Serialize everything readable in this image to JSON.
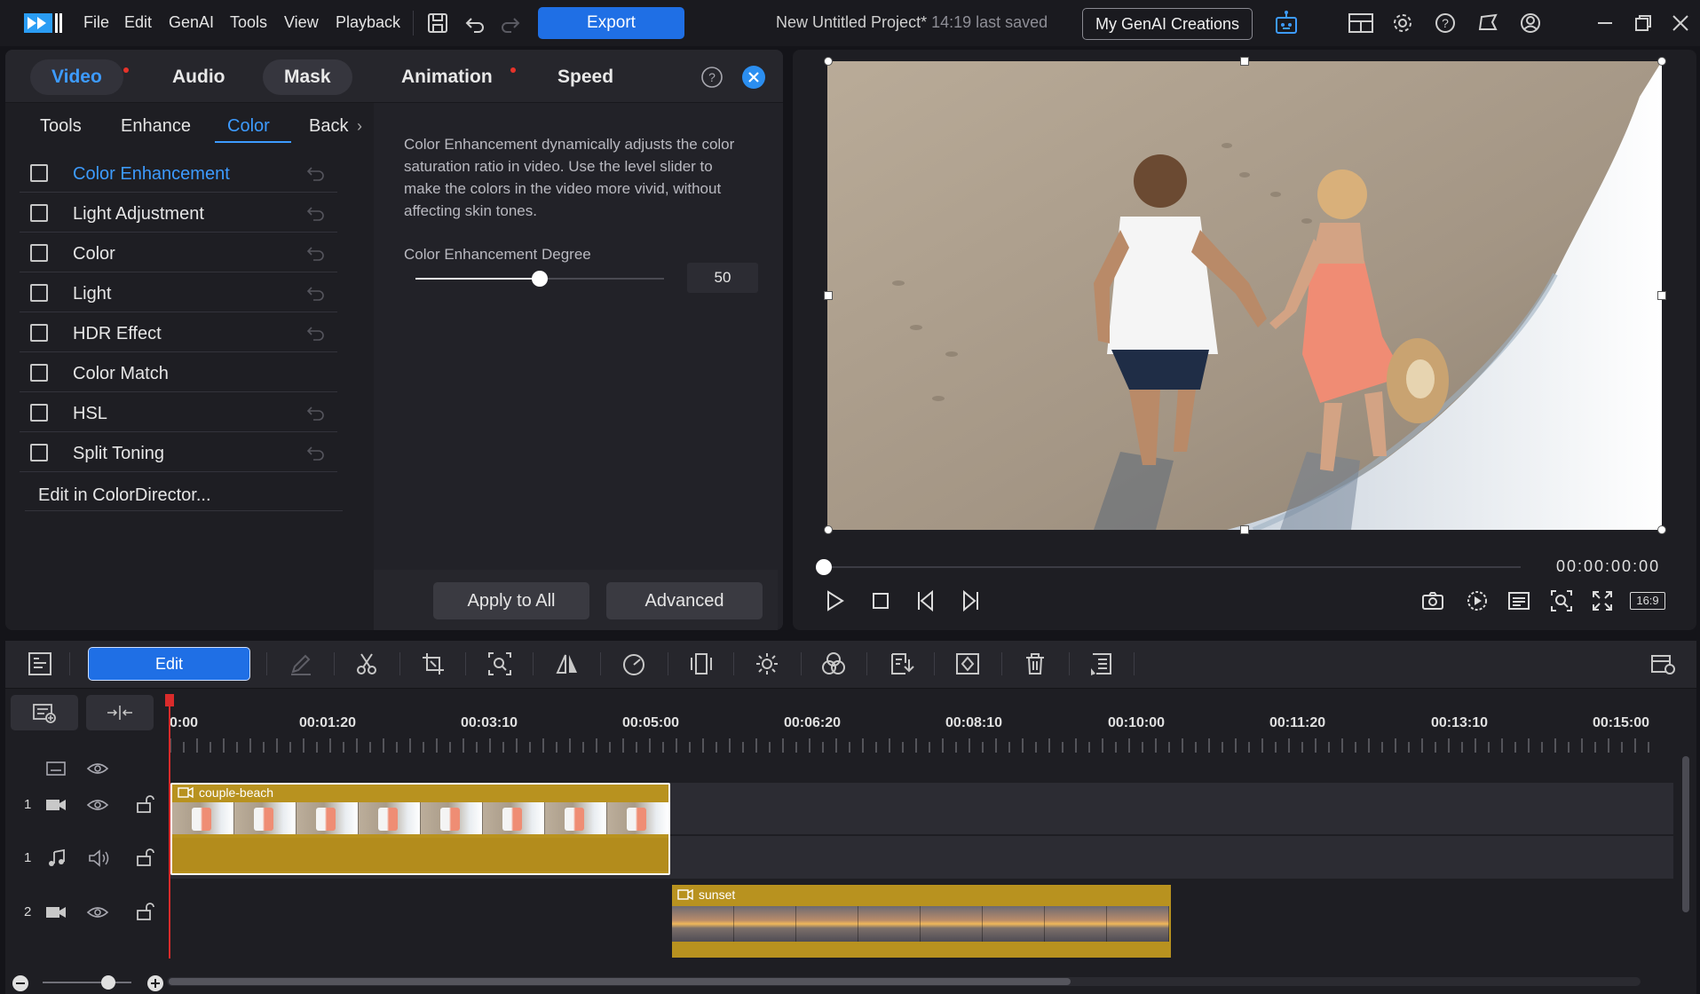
{
  "app": {
    "menu": [
      "File",
      "Edit",
      "GenAI",
      "Tools",
      "View",
      "Playback"
    ],
    "export_label": "Export",
    "project_title": "New Untitled Project*",
    "last_saved": "14:19 last saved",
    "genai_label": "My GenAI Creations"
  },
  "panel": {
    "tabs": [
      {
        "label": "Video",
        "dot": true
      },
      {
        "label": "Audio"
      },
      {
        "label": "Mask"
      },
      {
        "label": "Animation",
        "dot": true
      },
      {
        "label": "Speed"
      }
    ],
    "subtabs": [
      "Tools",
      "Enhance",
      "Color",
      "Back"
    ],
    "options": [
      {
        "label": "Color Enhancement",
        "active": true
      },
      {
        "label": "Light Adjustment"
      },
      {
        "label": "Color"
      },
      {
        "label": "Light"
      },
      {
        "label": "HDR Effect"
      },
      {
        "label": "Color Match"
      },
      {
        "label": "HSL"
      },
      {
        "label": "Split Toning"
      }
    ],
    "colordirector_label": "Edit in ColorDirector...",
    "description": "Color Enhancement dynamically adjusts the color saturation ratio in video. Use the level slider to make the colors in the video more vivid, without affecting skin tones.",
    "degree_label": "Color Enhancement Degree",
    "degree_value": "50",
    "degree_fraction": 0.5,
    "apply_all_label": "Apply to All",
    "advanced_label": "Advanced"
  },
  "preview": {
    "timecode": "00:00:00:00",
    "aspect_label": "16:9"
  },
  "timeline": {
    "edit_label": "Edit",
    "ruler": [
      "0:00",
      "00:01:20",
      "00:03:10",
      "00:05:00",
      "00:06:20",
      "00:08:10",
      "00:10:00",
      "00:11:20",
      "00:13:10",
      "00:15:00"
    ],
    "tracks": [
      {
        "number": "1",
        "kind": "video"
      },
      {
        "number": "1",
        "kind": "audio"
      },
      {
        "number": "2",
        "kind": "video"
      }
    ],
    "clips": [
      {
        "name": "couple-beach",
        "track": 1
      },
      {
        "name": "sunset",
        "track": 3
      }
    ]
  },
  "colors": {
    "accent": "#1f6fe5",
    "active_text": "#3d9bff",
    "clip": "#b8921f",
    "playhead": "#d92b2b"
  }
}
